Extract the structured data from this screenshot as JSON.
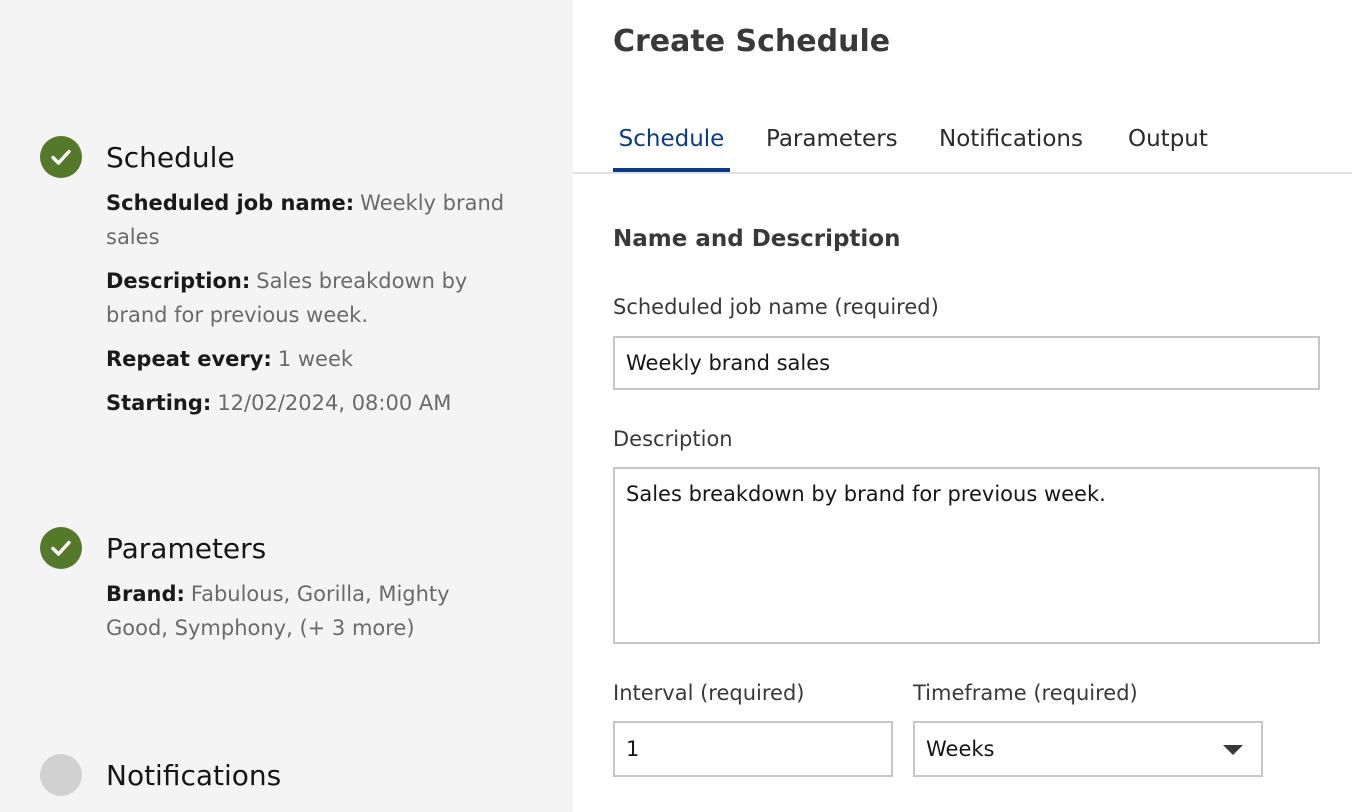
{
  "sidebar": {
    "steps": [
      {
        "title": "Schedule",
        "status": "complete",
        "details": [
          {
            "key": "Scheduled job name:",
            "value": "Weekly brand sales"
          },
          {
            "key": "Description:",
            "value": "Sales breakdown by brand for previous week."
          },
          {
            "key": "Repeat every:",
            "value": "1 week"
          },
          {
            "key": "Starting:",
            "value": "12/02/2024, 08:00 AM"
          }
        ]
      },
      {
        "title": "Parameters",
        "status": "complete",
        "details": [
          {
            "key": "Brand:",
            "value": "Fabulous, Gorilla, Mighty Good, Symphony, (+ 3 more)"
          }
        ]
      },
      {
        "title": "Notifications",
        "status": "pending"
      }
    ]
  },
  "main": {
    "title": "Create Schedule",
    "tabs": [
      "Schedule",
      "Parameters",
      "Notifications",
      "Output"
    ],
    "active_tab": "Schedule",
    "section_title": "Name and Description",
    "job_name": {
      "label": "Scheduled job name (required)",
      "value": "Weekly brand sales"
    },
    "description": {
      "label": "Description",
      "value": "Sales breakdown by brand for previous week."
    },
    "interval": {
      "label": "Interval (required)",
      "value": "1"
    },
    "timeframe": {
      "label": "Timeframe (required)",
      "value": "Weeks"
    }
  },
  "colors": {
    "complete": "#54792a",
    "pending": "#d1d1d1",
    "accent": "#0b3b84",
    "sidebar_bg": "#f4f4f4"
  },
  "icons": {
    "complete": "checkmark-circle-icon",
    "pending": "empty-circle-icon",
    "dropdown": "caret-down-icon"
  }
}
